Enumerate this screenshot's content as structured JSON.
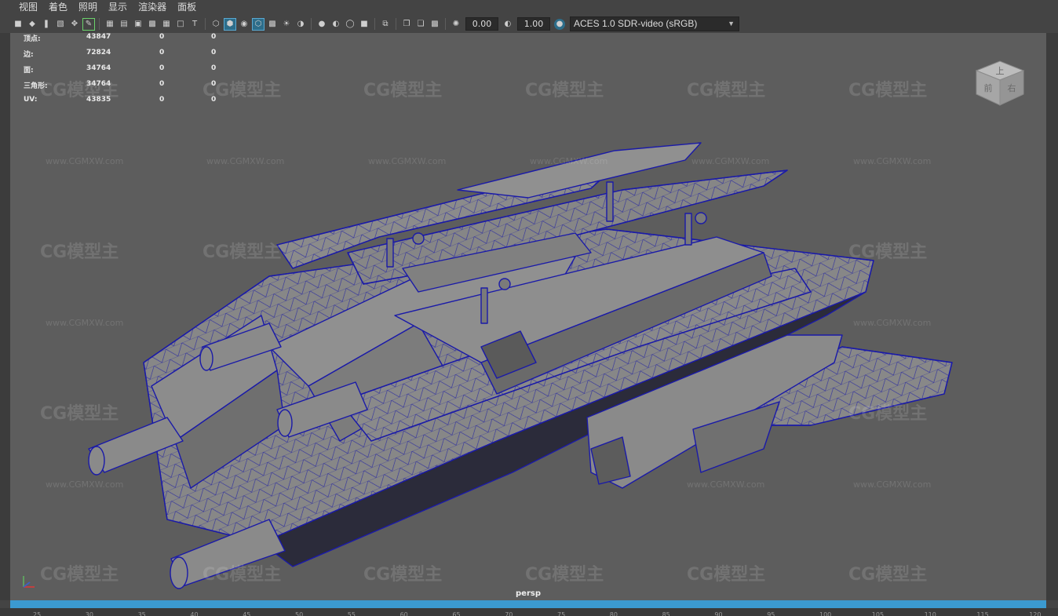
{
  "menubar": {
    "items": [
      "视图",
      "着色",
      "照明",
      "显示",
      "渲染器",
      "面板"
    ]
  },
  "toolbar": {
    "group1_icons": [
      "camera-icon",
      "camera-attr-icon",
      "bookmark-icon",
      "image-plane-icon",
      "pan-zoom-icon",
      "grease-pencil-icon"
    ],
    "group2_icons": [
      "grid-icon",
      "film-gate-icon",
      "resolution-gate-icon",
      "gate-mask-icon",
      "field-chart-icon",
      "safe-action-icon",
      "safe-title-icon"
    ],
    "group3_icons": [
      "wireframe-icon",
      "smooth-shade-icon",
      "default-material-icon",
      "wireframe-on-shaded-icon",
      "textured-icon",
      "use-lights-icon",
      "shadows-icon"
    ],
    "group4_icons": [
      "ambient-occlusion-icon",
      "motion-blur-icon",
      "anti-aliasing-icon",
      "depth-of-field-icon"
    ],
    "group5_icons": [
      "isolate-select-icon",
      "xray-icon",
      "xray-joints-icon",
      "xray-components-icon"
    ],
    "exposure_value": "0.00",
    "gamma_value": "1.00",
    "color_management_label": "ACES 1.0 SDR-video (sRGB)"
  },
  "hud": {
    "rows": [
      {
        "label": "顶点:",
        "v1": "43847",
        "v2": "0",
        "v3": "0"
      },
      {
        "label": "边:",
        "v1": "72824",
        "v2": "0",
        "v3": "0"
      },
      {
        "label": "面:",
        "v1": "34764",
        "v2": "0",
        "v3": "0"
      },
      {
        "label": "三角形:",
        "v1": "34764",
        "v2": "0",
        "v3": "0"
      },
      {
        "label": "UV:",
        "v1": "43835",
        "v2": "0",
        "v3": "0"
      }
    ]
  },
  "viewport": {
    "camera_label": "persp",
    "viewcube_faces": [
      "上",
      "前",
      "右"
    ]
  },
  "watermark": {
    "logo_text": "CG模型主",
    "url_text": "www.CGMXW.com"
  },
  "timeline": {
    "ticks": [
      "25",
      "30",
      "35",
      "40",
      "45",
      "50",
      "55",
      "60",
      "65",
      "70",
      "75",
      "80",
      "85",
      "90",
      "95",
      "100",
      "105",
      "110",
      "115",
      "120"
    ]
  },
  "colors": {
    "viewport_bg": "#5d5d5d",
    "wire": "#1a1aa8",
    "timebar": "#3b9ad0"
  }
}
